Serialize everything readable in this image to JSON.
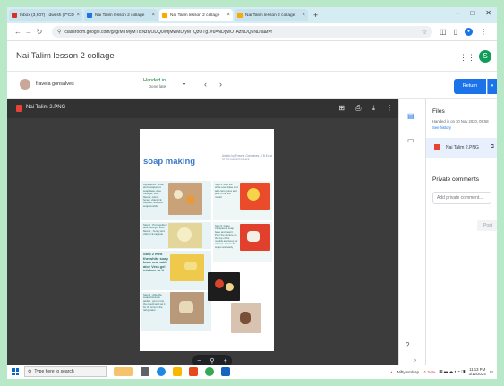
{
  "tabs": [
    {
      "label": "Inbox (3,907) - dwesh (7*CD)",
      "color": "#d93025",
      "active": false
    },
    {
      "label": "Nai Talim lesson 2 collage",
      "color": "#1a73e8",
      "active": false
    },
    {
      "label": "Nai Talim lesson 2 collage",
      "color": "#f9ab00",
      "active": true
    },
    {
      "label": "Nai Talim lesson 2 collage",
      "color": "#f9ab00",
      "active": false
    }
  ],
  "window_controls": {
    "minimize": "–",
    "maximize": "□",
    "close": "✕"
  },
  "address": {
    "url": "classroom.google.com/g/tg/MTMyMTIxNzIyODQ0/MjMwMDIyMTQzOTg1#u=NDgwOTAzNDQ5NDIa&t=f"
  },
  "header": {
    "title": "Nai Talim lesson 2 collage",
    "avatar_letter": "S"
  },
  "student": {
    "name": "fravela gonsalves",
    "status": "Handed in",
    "status_sub": "Done late",
    "return_label": "Return"
  },
  "viewer": {
    "file_name": "Nai Talim 2.PNG",
    "page_title": "soap making",
    "byline": "Artistic by Fravela Gonsalves , I B.Ed st 37 ST.XAVIERS 3412",
    "panels": {
      "p1": "Ingredients : white and transparent soap base, Aloe Vera gel, food flavour, carrot, honey, vitamin E capsule, liner and soap moulds",
      "p2": "Step 1 : Put together aloe Vera gel, food flavour , honey and vitamin E capsule",
      "p3": "Step 2 melt the white soap base and add aloe Vera gel mixture to it",
      "p4": "Step 3 : After the soap mixture is added , pour it into the mould and set it for 30 mins in the refrigerator",
      "p5": "Step 4: Melt the white soap base and add carrot juice and pour it into the mould",
      "p6": "Step 5: Grate transparent soap base and heat it . Pour the mixture on the top of the moulds and keep for 2 hours. Hence the soaps are ready"
    },
    "zoom": {
      "minus": "−",
      "plus": "+"
    }
  },
  "side": {
    "files_heading": "Files",
    "handed_in_text": "Handed in on 30 Nov 2020, 09:58",
    "see_history": "See history",
    "file_name": "Nai Talim 2.PNG",
    "private_comments_heading": "Private comments",
    "comment_placeholder": "Add private comment...",
    "post_label": "Post"
  },
  "taskbar": {
    "search_placeholder": "Type here to search",
    "market_name": "Nifty smlcap",
    "market_change": "-1.24%",
    "time": "11:13 PM",
    "date": "3/12/2024"
  }
}
